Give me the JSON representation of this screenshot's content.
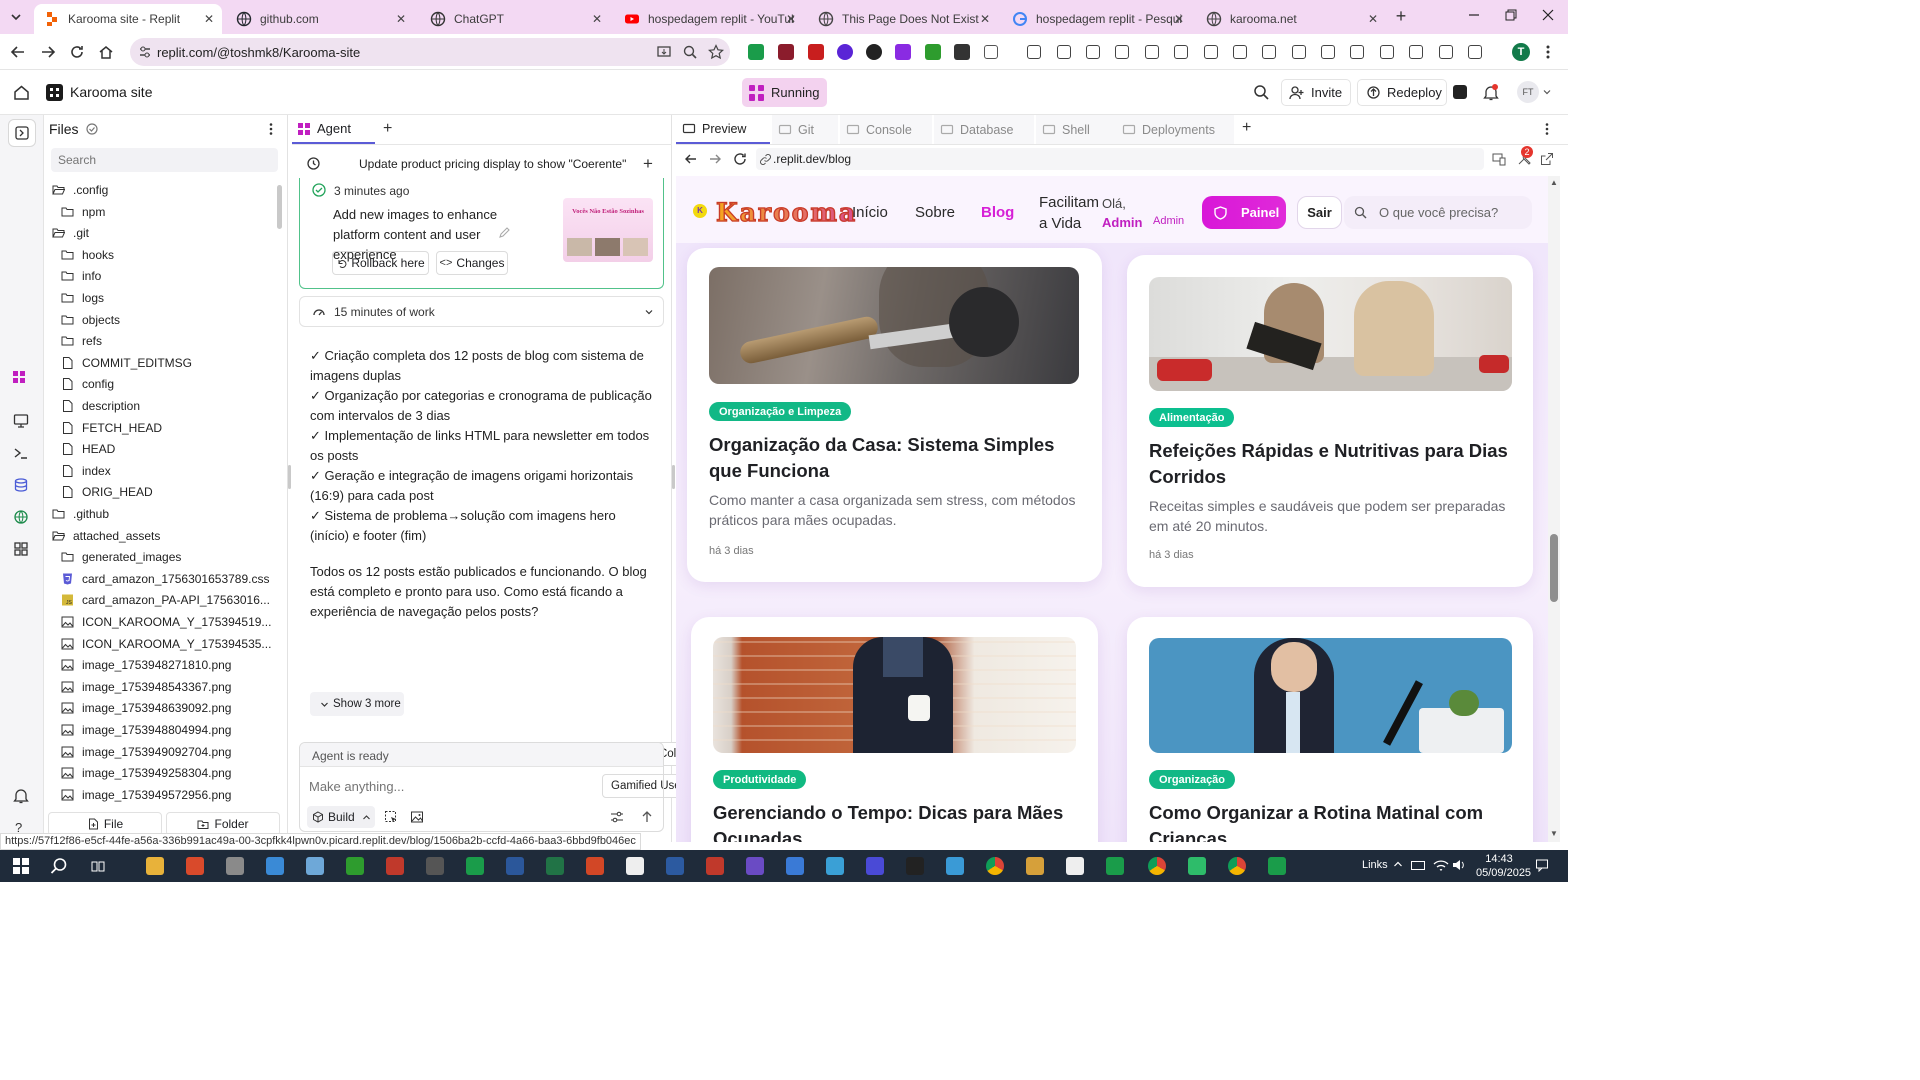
{
  "browser": {
    "tabs": [
      {
        "label": "Karooma site - Replit",
        "active": true,
        "icon": "replit-icon"
      },
      {
        "label": "github.com",
        "icon": "github-icon"
      },
      {
        "label": "ChatGPT",
        "icon": "chatgpt-icon"
      },
      {
        "label": "hospedagem replit - YouTube",
        "icon": "youtube-icon"
      },
      {
        "label": "This Page Does Not Exist",
        "icon": "globe-icon"
      },
      {
        "label": "hospedagem replit - Pesquisa G",
        "icon": "google-icon"
      },
      {
        "label": "karooma.net",
        "icon": "globe-icon"
      }
    ],
    "url": "replit.com/@toshmk8/Karooma-site",
    "profile_initial": "T",
    "status_url": "https://57f12f86-e5cf-44fe-a56a-336b991ac49a-00-3cpfkk4lpwn0v.picard.replit.dev/blog/1506ba2b-ccfd-4a66-baa3-6bbd9fb046ec"
  },
  "replit": {
    "project_name": "Karooma site",
    "run_status": "Running",
    "invite_label": "Invite",
    "redeploy_label": "Redeploy",
    "avatar_initials": "FT"
  },
  "files": {
    "title": "Files",
    "search_placeholder": "Search",
    "items": [
      {
        "name": ".config",
        "type": "folder-open",
        "indent": 0
      },
      {
        "name": "npm",
        "type": "folder",
        "indent": 1
      },
      {
        "name": ".git",
        "type": "folder-open",
        "indent": 0
      },
      {
        "name": "hooks",
        "type": "folder",
        "indent": 1
      },
      {
        "name": "info",
        "type": "folder",
        "indent": 1
      },
      {
        "name": "logs",
        "type": "folder",
        "indent": 1
      },
      {
        "name": "objects",
        "type": "folder",
        "indent": 1
      },
      {
        "name": "refs",
        "type": "folder",
        "indent": 1
      },
      {
        "name": "COMMIT_EDITMSG",
        "type": "file",
        "indent": 1
      },
      {
        "name": "config",
        "type": "file",
        "indent": 1
      },
      {
        "name": "description",
        "type": "file",
        "indent": 1
      },
      {
        "name": "FETCH_HEAD",
        "type": "file",
        "indent": 1
      },
      {
        "name": "HEAD",
        "type": "file",
        "indent": 1
      },
      {
        "name": "index",
        "type": "file",
        "indent": 1
      },
      {
        "name": "ORIG_HEAD",
        "type": "file",
        "indent": 1
      },
      {
        "name": ".github",
        "type": "folder",
        "indent": 0
      },
      {
        "name": "attached_assets",
        "type": "folder-open",
        "indent": 0
      },
      {
        "name": "generated_images",
        "type": "folder",
        "indent": 1
      },
      {
        "name": "card_amazon_1756301653789.css",
        "type": "css",
        "indent": 1
      },
      {
        "name": "card_amazon_PA-API_17563016...",
        "type": "js",
        "indent": 1
      },
      {
        "name": "ICON_KAROOMA_Y_175394519...",
        "type": "image",
        "indent": 1
      },
      {
        "name": "ICON_KAROOMA_Y_175394535...",
        "type": "image",
        "indent": 1
      },
      {
        "name": "image_1753948271810.png",
        "type": "image",
        "indent": 1
      },
      {
        "name": "image_1753948543367.png",
        "type": "image",
        "indent": 1
      },
      {
        "name": "image_1753948639092.png",
        "type": "image",
        "indent": 1
      },
      {
        "name": "image_1753948804994.png",
        "type": "image",
        "indent": 1
      },
      {
        "name": "image_1753949092704.png",
        "type": "image",
        "indent": 1
      },
      {
        "name": "image_1753949258304.png",
        "type": "image",
        "indent": 1
      },
      {
        "name": "image_1753949572956.png",
        "type": "image",
        "indent": 1
      }
    ],
    "new_file_label": "File",
    "new_folder_label": "Folder"
  },
  "agent": {
    "tab_label": "Agent",
    "thread_title": "Update product pricing display to show \"Coerente\"",
    "checkpoint_time": "3 minutes ago",
    "checkpoint_text": "Add new images to enhance platform content and user experience",
    "thumb_text": "Vocês Não Estão Sozinhas",
    "rollback_label": "Rollback here",
    "changes_label": "Changes",
    "work_label": "15 minutes of work",
    "bullets": [
      "✓ Criação completa dos 12 posts de blog com sistema de imagens duplas",
      "✓ Organização por categorias e cronograma de publicação com intervalos de 3 dias",
      "✓ Implementação de links HTML para newsletter em todos os posts",
      "✓ Geração e integração de imagens origami horizontais (16:9) para cada post",
      "✓ Sistema de problema→solução com imagens hero (início) e footer (fim)"
    ],
    "summary": "Todos os 12 posts estão publicados e funcionando. O blog está completo e pronto para uso. Como está ficando a experiência de navegação pelos posts?",
    "suggestions": [
      "Adaptive Color Palette Generator Based on User Interactions",
      "Gamified User Progress Tracker with Reward Milestones"
    ],
    "show_more": "Show 3 more",
    "status": "Agent is ready",
    "input_placeholder": "Make anything...",
    "build_label": "Build"
  },
  "preview": {
    "tabs": [
      "Preview",
      "Git",
      "Console",
      "Database",
      "Shell",
      "Deployments"
    ],
    "url": ".replit.dev/blog",
    "notif_count": "2"
  },
  "site": {
    "logo": "Karooma",
    "nav": [
      "Início",
      "Sobre",
      "Blog",
      "Facilitam a Vida"
    ],
    "greeting": "Olá,",
    "user": "Admin",
    "role": "Admin",
    "panel_button": "Painel",
    "logout_button": "Sair",
    "search_placeholder": "O que você precisa?",
    "posts": [
      {
        "category": "Organização e Limpeza",
        "category_color": "#12b886",
        "title": "Organização da Casa: Sistema Simples que Funciona",
        "desc": "Como manter a casa organizada sem stress, com métodos práticos para mães ocupadas.",
        "date": "há 3 dias"
      },
      {
        "category": "Alimentação",
        "category_color": "#0cbf8f",
        "title": "Refeições Rápidas e Nutritivas para Dias Corridos",
        "desc": "Receitas simples e saudáveis que podem ser preparadas em até 20 minutos.",
        "date": "há 3 dias"
      },
      {
        "category": "Produtividade",
        "category_color": "#10b981",
        "title": "Gerenciando o Tempo: Dicas para Mães Ocupadas",
        "desc": "",
        "date": ""
      },
      {
        "category": "Organização",
        "category_color": "#12b886",
        "title": "Como Organizar a Rotina Matinal com Crianças",
        "desc": "",
        "date": ""
      }
    ]
  },
  "taskbar": {
    "links_label": "Links",
    "time": "14:43",
    "date": "05/09/2025"
  },
  "colors": {
    "brand_magenta": "#d61fd6",
    "running_bg": "#f3d2ef",
    "tab_strip": "#f3d9f3",
    "agent_accent": "#5b5bd6"
  }
}
